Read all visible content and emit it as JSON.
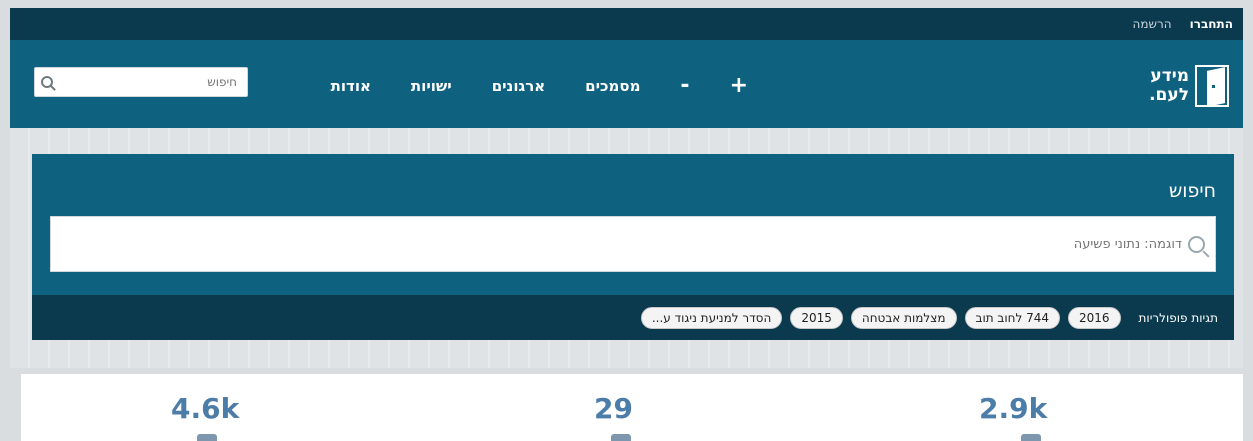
{
  "topbar": {
    "register": "הרשמה",
    "login": "התחברו"
  },
  "logo": {
    "line1": "מידע",
    "line2": "לעם."
  },
  "nav": {
    "plus": "+",
    "minus": "-",
    "documents": "מסמכים",
    "organizations": "ארגונים",
    "entities": "ישויות",
    "about": "אודות",
    "search_placeholder": "חיפוש"
  },
  "search_panel": {
    "title": "חיפוש",
    "placeholder": "דוגמה: נתוני פשיעה"
  },
  "tags": {
    "label": "תגיות פופולריות",
    "items": [
      "2016",
      "744 לחוב תוב",
      "מצלמות אבטחה",
      "2015",
      "הסדר למניעת ניגוד ע..."
    ]
  },
  "stats": {
    "values": [
      "2.9k",
      "29",
      "4.6k"
    ]
  },
  "colors": {
    "topbar": "#0b3a4f",
    "navbar": "#0f6180",
    "stat_text": "#4c7ca8"
  }
}
